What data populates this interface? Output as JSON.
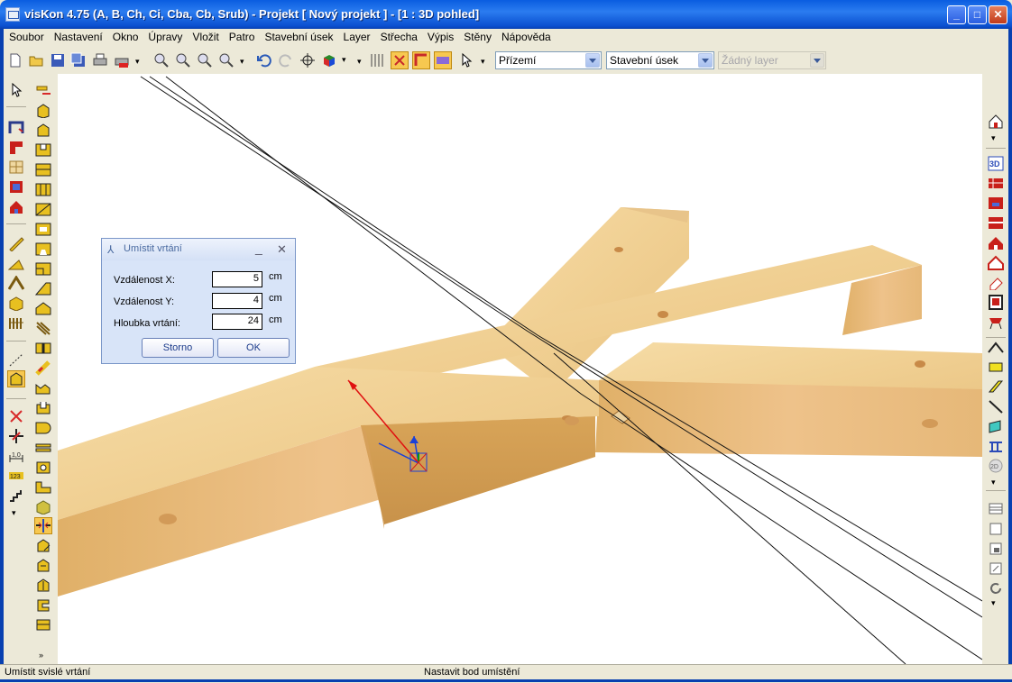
{
  "window": {
    "title": "visKon 4.75 (A, B, Ch, Ci, Cba, Cb, Srub) - Projekt [ Nový projekt ]  - [1 : 3D pohled]"
  },
  "menu": [
    {
      "label": "Soubor"
    },
    {
      "label": "Nastavení"
    },
    {
      "label": "Okno"
    },
    {
      "label": "Úpravy"
    },
    {
      "label": "Vložit"
    },
    {
      "label": "Patro"
    },
    {
      "label": "Stavební úsek"
    },
    {
      "label": "Layer"
    },
    {
      "label": "Střecha"
    },
    {
      "label": "Výpis"
    },
    {
      "label": "Stěny"
    },
    {
      "label": "Nápověda"
    }
  ],
  "toolbar": {
    "floor_select": "Přízemí",
    "section_select": "Stavební úsek",
    "layer_select": "Žádný layer"
  },
  "dialog": {
    "title": "Umístit vrtání",
    "fields": [
      {
        "label": "Vzdálenost X:",
        "value": "5",
        "unit": "cm"
      },
      {
        "label": "Vzdálenost Y:",
        "value": "4",
        "unit": "cm"
      },
      {
        "label": "Hloubka vrtání:",
        "value": "24",
        "unit": "cm"
      }
    ],
    "cancel_label": "Storno",
    "ok_label": "OK"
  },
  "status": {
    "left": "Umístit svislé vrtání",
    "center": "Nastavit bod umístění"
  },
  "icons": [
    "new-file-icon",
    "open-folder-icon",
    "save-icon",
    "save-all-icon",
    "print-icon",
    "print-preview-icon",
    "zoom-in-icon",
    "zoom-out-icon",
    "zoom-window-icon",
    "zoom-all-icon",
    "undo-icon",
    "redo-icon",
    "crosshair-icon",
    "3d-cube-icon",
    "grid-icon",
    "snap-icon",
    "pointer-icon"
  ]
}
